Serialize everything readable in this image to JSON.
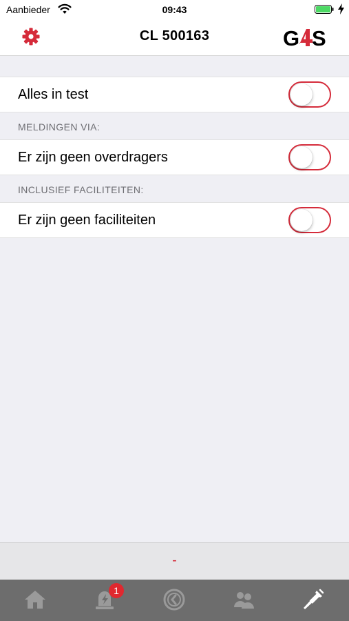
{
  "status_bar": {
    "carrier": "Aanbieder",
    "time": "09:43"
  },
  "nav": {
    "title": "CL 500163",
    "logo_text": "G4S"
  },
  "rows": [
    {
      "label": "Alles in test",
      "on": false
    },
    {
      "label": "Er zijn geen overdragers",
      "on": false
    },
    {
      "label": "Er zijn geen faciliteiten",
      "on": false
    }
  ],
  "sections": {
    "meldingen": "MELDINGEN VIA:",
    "faciliteiten": "INCLUSIEF FACILITEITEN:"
  },
  "bottom_strip": {
    "text": "-"
  },
  "tabs": [
    {
      "icon": "home-icon"
    },
    {
      "icon": "alarm-icon",
      "badge": "1"
    },
    {
      "icon": "history-clock-icon"
    },
    {
      "icon": "users-icon"
    },
    {
      "icon": "tools-icon",
      "active": true
    }
  ],
  "colors": {
    "accent": "#d52b3a",
    "tab_bar": "#6d6d6d",
    "background": "#efeff4"
  }
}
